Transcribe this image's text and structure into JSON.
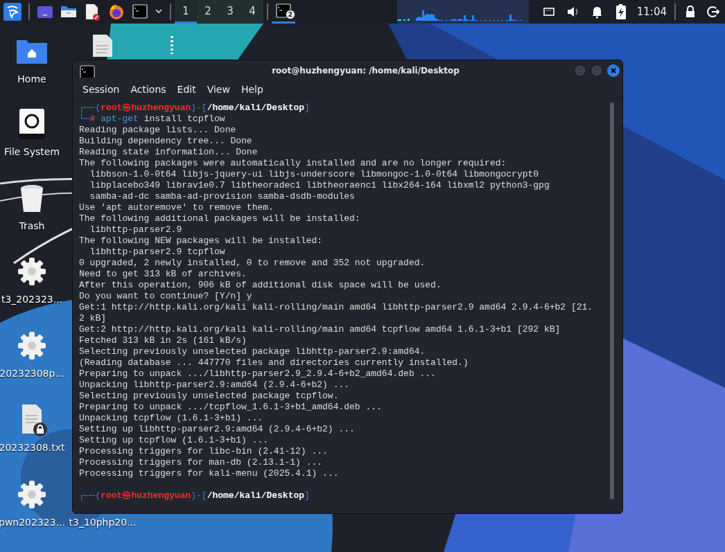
{
  "taskbar": {
    "launchers": [
      {
        "kind": "menu"
      },
      {
        "kind": "desktop"
      },
      {
        "kind": "files"
      },
      {
        "kind": "editor"
      },
      {
        "kind": "browser"
      },
      {
        "kind": "terminal"
      },
      {
        "kind": "dropdown"
      }
    ],
    "workspaces": [
      {
        "label": "1",
        "selected": true
      },
      {
        "label": "2",
        "selected": false
      },
      {
        "label": "3",
        "selected": false
      },
      {
        "label": "4",
        "selected": false
      }
    ],
    "tasks": [
      {
        "kind": "terminal",
        "badge": "2",
        "selected": true
      }
    ],
    "tray": [
      {
        "kind": "network"
      },
      {
        "kind": "volume"
      },
      {
        "kind": "bell"
      },
      {
        "kind": "battery"
      }
    ],
    "clock": "11:04",
    "actions": [
      {
        "kind": "lock"
      },
      {
        "kind": "logout"
      }
    ]
  },
  "desktop": {
    "icons": [
      {
        "kind": "home",
        "label": "Home"
      },
      {
        "kind": "drive",
        "label": "File System"
      },
      {
        "kind": "trash",
        "label": "Trash"
      },
      {
        "kind": "gear",
        "label": "t3_202323..."
      },
      {
        "kind": "gear",
        "label": "20232308p..."
      },
      {
        "kind": "locked-file",
        "label": "20232308.txt"
      },
      {
        "kind": "gear",
        "label": "pwn202323..."
      },
      {
        "kind": "file"
      },
      {
        "kind": "zip"
      },
      {
        "kind": "gear-hidden",
        "label": "t3_10php20..."
      }
    ]
  },
  "terminal": {
    "title": "root@huzhengyuan: /home/kali/Desktop",
    "buttons": [
      {
        "kind": "minimize"
      },
      {
        "kind": "maximize"
      },
      {
        "kind": "close"
      }
    ],
    "menu": [
      "Session",
      "Actions",
      "Edit",
      "View",
      "Help"
    ],
    "lines": [
      {
        "kind": "prompt",
        "open": "┌──(",
        "user": "root",
        "at": "㉿",
        "host": "huzhengyuan",
        "sep": ")-[",
        "path": "/home/kali/Desktop",
        "close": "]"
      },
      {
        "kind": "command",
        "corner": "└─",
        "mark": "#",
        "program": "apt-get",
        "args": "install tcpflow"
      },
      {
        "kind": "text",
        "text": "Reading package lists... Done"
      },
      {
        "kind": "text",
        "text": "Building dependency tree... Done"
      },
      {
        "kind": "text",
        "text": "Reading state information... Done"
      },
      {
        "kind": "text",
        "text": "The following packages were automatically installed and are no longer required:"
      },
      {
        "kind": "text",
        "text": "  libbson-1.0-0t64 libjs-jquery-ui libjs-underscore libmongoc-1.0-0t64 libmongocrypt0"
      },
      {
        "kind": "text",
        "text": "  libplacebo349 librav1e0.7 libtheoradec1 libtheoraenc1 libx264-164 libxml2 python3-gpg"
      },
      {
        "kind": "text",
        "text": "  samba-ad-dc samba-ad-provision samba-dsdb-modules"
      },
      {
        "kind": "text",
        "text": "Use 'apt autoremove' to remove them."
      },
      {
        "kind": "text",
        "text": "The following additional packages will be installed:"
      },
      {
        "kind": "text",
        "text": "  libhttp-parser2.9"
      },
      {
        "kind": "text",
        "text": "The following NEW packages will be installed:"
      },
      {
        "kind": "text",
        "text": "  libhttp-parser2.9 tcpflow"
      },
      {
        "kind": "text",
        "text": "0 upgraded, 2 newly installed, 0 to remove and 352 not upgraded."
      },
      {
        "kind": "text",
        "text": "Need to get 313 kB of archives."
      },
      {
        "kind": "text",
        "text": "After this operation, 906 kB of additional disk space will be used."
      },
      {
        "kind": "text",
        "text": "Do you want to continue? [Y/n] y"
      },
      {
        "kind": "text",
        "text": "Get:1 http://http.kali.org/kali kali-rolling/main amd64 libhttp-parser2.9 amd64 2.9.4-6+b2 [21."
      },
      {
        "kind": "text",
        "text": "2 kB]"
      },
      {
        "kind": "text",
        "text": "Get:2 http://http.kali.org/kali kali-rolling/main amd64 tcpflow amd64 1.6.1-3+b1 [292 kB]"
      },
      {
        "kind": "text",
        "text": "Fetched 313 kB in 2s (161 kB/s)"
      },
      {
        "kind": "text",
        "text": "Selecting previously unselected package libhttp-parser2.9:amd64."
      },
      {
        "kind": "text",
        "text": "(Reading database ... 447770 files and directories currently installed.)"
      },
      {
        "kind": "text",
        "text": "Preparing to unpack .../libhttp-parser2.9_2.9.4-6+b2_amd64.deb ..."
      },
      {
        "kind": "text",
        "text": "Unpacking libhttp-parser2.9:amd64 (2.9.4-6+b2) ..."
      },
      {
        "kind": "text",
        "text": "Selecting previously unselected package tcpflow."
      },
      {
        "kind": "text",
        "text": "Preparing to unpack .../tcpflow_1.6.1-3+b1_amd64.deb ..."
      },
      {
        "kind": "text",
        "text": "Unpacking tcpflow (1.6.1-3+b1) ..."
      },
      {
        "kind": "text",
        "text": "Setting up libhttp-parser2.9:amd64 (2.9.4-6+b2) ..."
      },
      {
        "kind": "text",
        "text": "Setting up tcpflow (1.6.1-3+b1) ..."
      },
      {
        "kind": "text",
        "text": "Processing triggers for libc-bin (2.41-12) ..."
      },
      {
        "kind": "text",
        "text": "Processing triggers for man-db (2.13.1-1) ..."
      },
      {
        "kind": "text",
        "text": "Processing triggers for kali-menu (2025.4.1) ..."
      },
      {
        "kind": "blank"
      },
      {
        "kind": "prompt",
        "open": "┌──(",
        "user": "root",
        "at": "㉿",
        "host": "huzhengyuan",
        "sep": ")-[",
        "path": "/home/kali/Desktop",
        "close": "]"
      }
    ]
  }
}
